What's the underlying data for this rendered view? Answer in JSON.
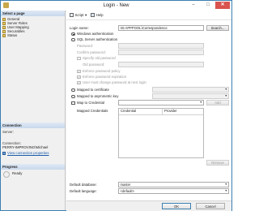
{
  "window": {
    "title": "Login - New",
    "minimize": "–",
    "maximize": "□",
    "close": "✕"
  },
  "left_panel": {
    "select_page_header": "Select a page",
    "pages": [
      {
        "label": "General",
        "icon": "page-icon"
      },
      {
        "label": "Server Roles",
        "icon": "page-icon"
      },
      {
        "label": "User Mapping",
        "icon": "page-icon"
      },
      {
        "label": "Securables",
        "icon": "page-icon"
      },
      {
        "label": "Status",
        "icon": "page-icon"
      }
    ],
    "connection_header": "Connection",
    "server_label": "Server:",
    "server_value": "",
    "connection_label": "Connection:",
    "connection_value": "PERRY-IMPROVING\\Michael",
    "view_connection_properties": "View connection properties",
    "progress_header": "Progress",
    "progress_status": "Ready"
  },
  "toolbar": {
    "script": "Script",
    "script_dropdown": "▾",
    "help": "Help"
  },
  "form": {
    "login_name_label": "Login name:",
    "login_name_value": "IIS APPPOOL\\Correspondence",
    "search_button": "Search...",
    "windows_auth": "Windows authentication",
    "sql_auth": "SQL Server authentication",
    "password_label": "Password:",
    "confirm_password_label": "Confirm password:",
    "specify_old_password": "Specify old password",
    "old_password_label": "Old password:",
    "enforce_policy": "Enforce password policy",
    "enforce_expiration": "Enforce password expiration",
    "must_change": "User must change password at next login",
    "mapped_certificate": "Mapped to certificate",
    "mapped_asym_key": "Mapped to asymmetric key",
    "map_credential": "Map to Credential",
    "add_button": "Add",
    "mapped_credentials_label": "Mapped Credentials",
    "grid_columns": [
      "Credential",
      "Provider"
    ],
    "remove_button": "Remove",
    "default_database_label": "Default database:",
    "default_database_value": "master",
    "default_language_label": "Default language:",
    "default_language_value": "<default>"
  },
  "footer": {
    "ok": "OK",
    "cancel": "Cancel"
  }
}
